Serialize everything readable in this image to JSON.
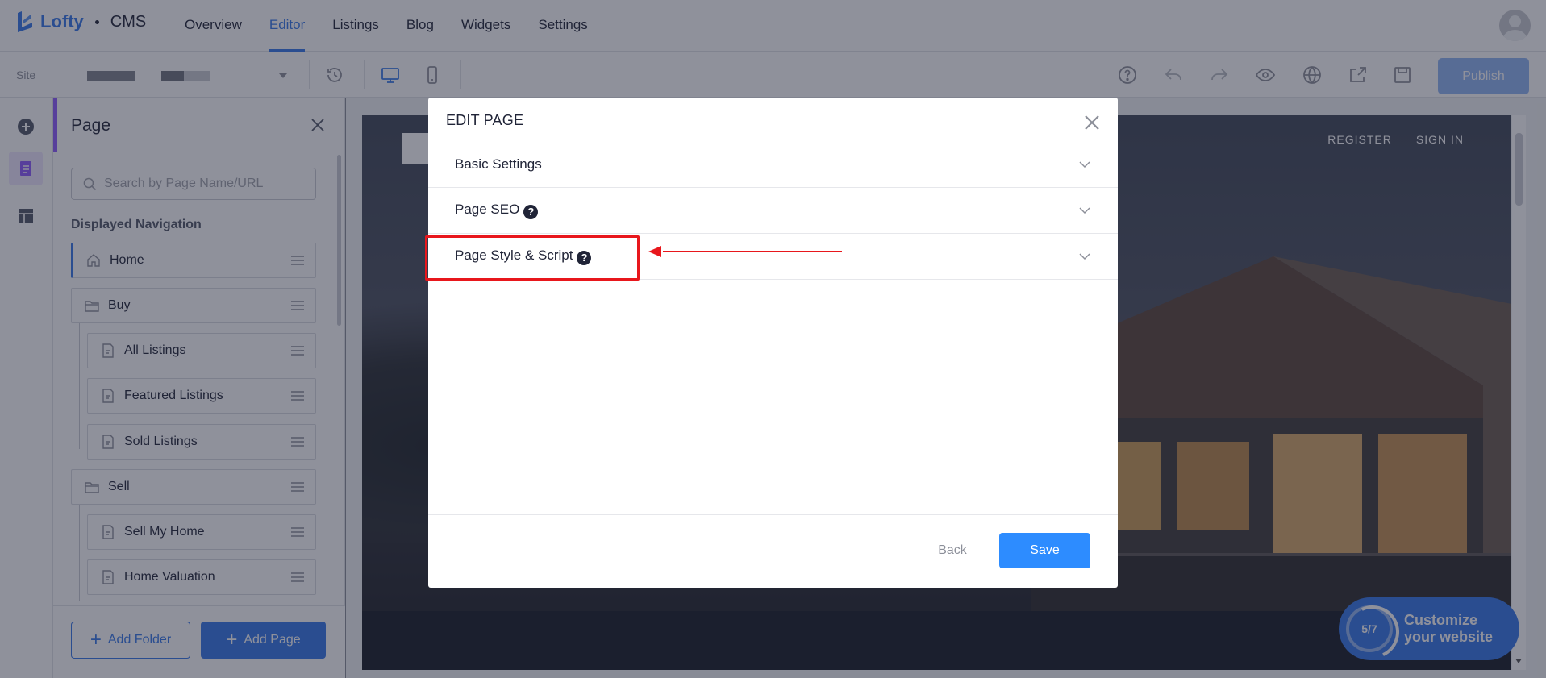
{
  "app": {
    "logo_text": "Lofty",
    "product": "CMS"
  },
  "topnav": {
    "items": [
      {
        "label": "Overview",
        "active": false
      },
      {
        "label": "Editor",
        "active": true
      },
      {
        "label": "Listings",
        "active": false
      },
      {
        "label": "Blog",
        "active": false
      },
      {
        "label": "Widgets",
        "active": false
      },
      {
        "label": "Settings",
        "active": false
      }
    ]
  },
  "toolbar": {
    "site_label": "Site",
    "publish_label": "Publish",
    "icons": [
      "history-icon",
      "desktop-icon",
      "mobile-icon",
      "help-icon",
      "undo-icon",
      "redo-icon",
      "preview-eye-icon",
      "globe-icon",
      "share-icon",
      "save-disk-icon"
    ]
  },
  "sidebar": {
    "title": "Page",
    "search_placeholder": "Search by Page Name/URL",
    "section_heading": "Displayed Navigation",
    "items": [
      {
        "label": "Home",
        "type": "home"
      },
      {
        "label": "Buy",
        "type": "folder"
      },
      {
        "label": "All Listings",
        "type": "page"
      },
      {
        "label": "Featured Listings",
        "type": "page"
      },
      {
        "label": "Sold Listings",
        "type": "page"
      },
      {
        "label": "Sell",
        "type": "folder"
      },
      {
        "label": "Sell My Home",
        "type": "page"
      },
      {
        "label": "Home Valuation",
        "type": "page"
      }
    ],
    "add_folder_label": "Add Folder",
    "add_page_label": "Add Page"
  },
  "preview": {
    "links": [
      "REGISTER",
      "SIGN IN"
    ]
  },
  "customize": {
    "progress": "5/7",
    "label": "Customize your website"
  },
  "dialog": {
    "title": "EDIT PAGE",
    "sections": [
      {
        "label": "Basic Settings",
        "help": false
      },
      {
        "label": "Page SEO",
        "help": true
      },
      {
        "label": "Page Style & Script",
        "help": true
      }
    ],
    "help_glyph": "?",
    "back_label": "Back",
    "save_label": "Save"
  },
  "colors": {
    "accent": "#3577e8",
    "save_button": "#2d8cff",
    "highlight": "#e8171c",
    "sidebar_accent": "#8f5bff"
  }
}
